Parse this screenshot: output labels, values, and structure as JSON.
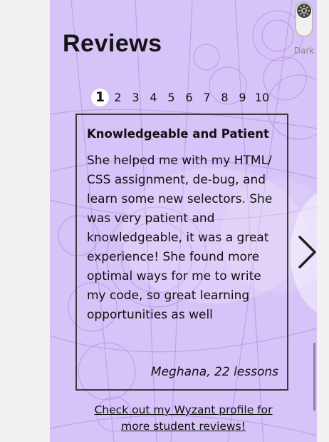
{
  "section": {
    "title": "Reviews"
  },
  "pagination": {
    "pages": [
      "1",
      "2",
      "3",
      "4",
      "5",
      "6",
      "7",
      "8",
      "9",
      "10"
    ],
    "active": "1"
  },
  "review": {
    "title": "Knowledgeable and Patient",
    "body_lines": [
      "She helped me with my HTML/",
      "CSS assignment, de-bug, and",
      "learn some new selectors. She",
      "was very patient and",
      "knowledgeable, it was a great",
      "experience! She found more",
      "optimal ways for me to write",
      "my code, so great learning",
      "opportunities as well"
    ],
    "author": "Meghana, 22 lessons"
  },
  "link": {
    "profile_lines": [
      "Check out my Wyzant profile for",
      "more student reviews!"
    ]
  },
  "theme_toggle": {
    "label": "Dark",
    "icon": "sun-icon"
  },
  "colors": {
    "panel_bg": "#d6c3f7",
    "page_bg": "#f1f1f1",
    "text": "#111111",
    "active_page_bg": "#ffffff"
  }
}
